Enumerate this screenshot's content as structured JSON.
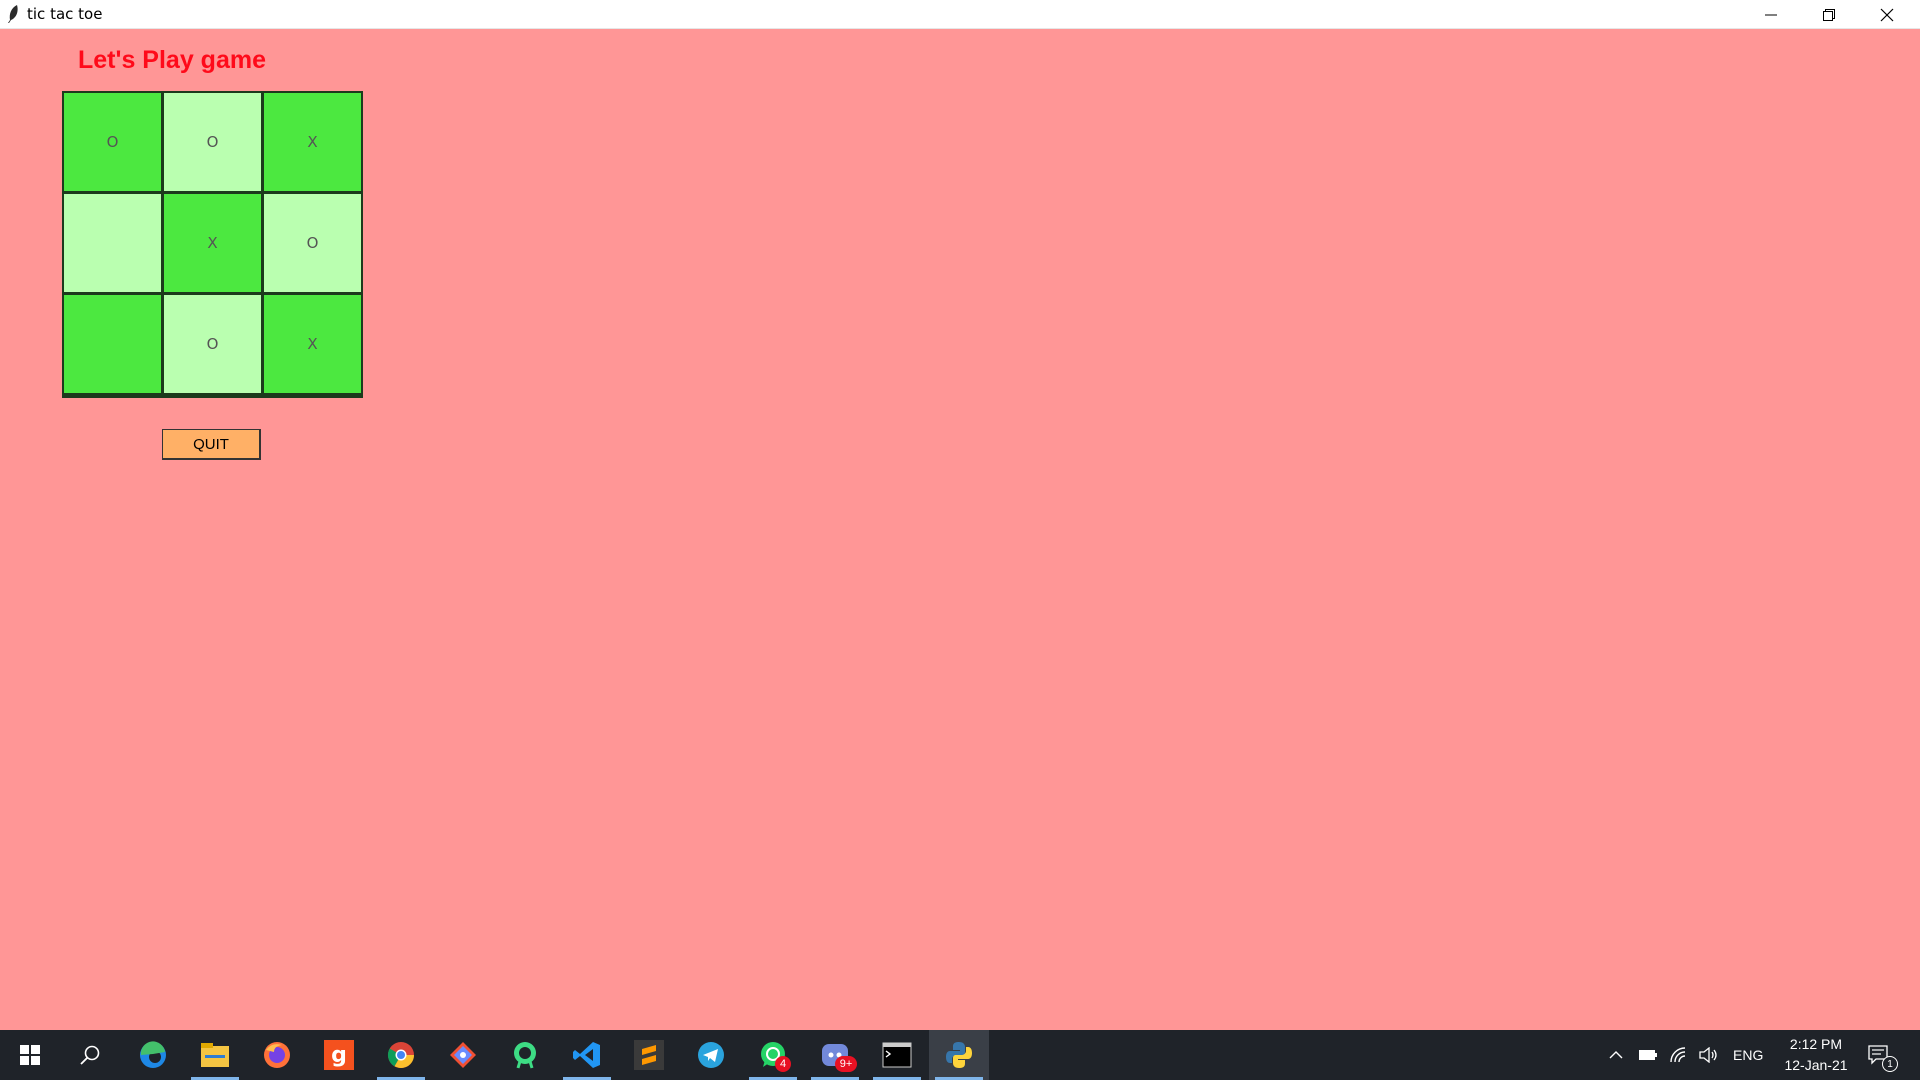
{
  "window": {
    "title": "tic tac toe"
  },
  "app": {
    "heading": "Let's Play game",
    "board": [
      [
        "O",
        "O",
        "X"
      ],
      [
        "",
        "X",
        "O"
      ],
      [
        "",
        "O",
        "X"
      ]
    ],
    "quit_label": "QUIT",
    "colors": {
      "background": "#ff9696",
      "heading": "#ff0a1a",
      "cell_dark": "#4ce840",
      "cell_light": "#baffb0",
      "quit_button": "#ffb066"
    }
  },
  "taskbar": {
    "apps": [
      {
        "icon": "edge-icon",
        "badge": null
      },
      {
        "icon": "file-explorer-icon",
        "badge": null
      },
      {
        "icon": "firefox-icon",
        "badge": null
      },
      {
        "icon": "g-app-icon",
        "badge": null
      },
      {
        "icon": "chrome-icon",
        "badge": null
      },
      {
        "icon": "git-icon",
        "badge": null
      },
      {
        "icon": "android-studio-icon",
        "badge": null
      },
      {
        "icon": "vscode-icon",
        "badge": null
      },
      {
        "icon": "sublime-text-icon",
        "badge": null
      },
      {
        "icon": "telegram-icon",
        "badge": null
      },
      {
        "icon": "whatsapp-icon",
        "badge": "4"
      },
      {
        "icon": "discord-icon",
        "badge": "9+"
      },
      {
        "icon": "terminal-icon",
        "badge": null
      },
      {
        "icon": "python-icon",
        "badge": null
      }
    ],
    "language": "ENG",
    "time": "2:12 PM",
    "date": "12-Jan-21",
    "notification_count": "1"
  }
}
